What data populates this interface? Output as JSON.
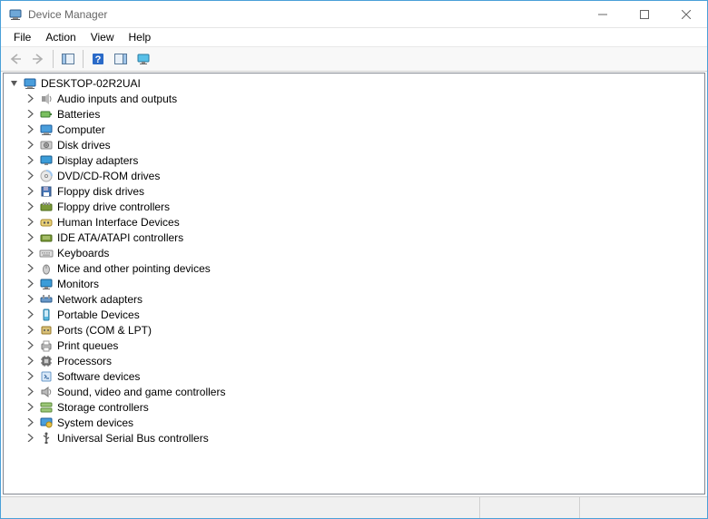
{
  "window": {
    "title": "Device Manager"
  },
  "menu": {
    "file": "File",
    "action": "Action",
    "view": "View",
    "help": "Help"
  },
  "toolbar": {
    "back": "back",
    "forward": "forward",
    "show_hide": "show-hide-console-tree",
    "help": "help",
    "action_pane": "show-hide-action-pane",
    "monitor": "monitor-action"
  },
  "tree": {
    "root": "DESKTOP-02R2UAI",
    "categories": [
      {
        "label": "Audio inputs and outputs",
        "icon": "speaker"
      },
      {
        "label": "Batteries",
        "icon": "battery"
      },
      {
        "label": "Computer",
        "icon": "computer"
      },
      {
        "label": "Disk drives",
        "icon": "disk"
      },
      {
        "label": "Display adapters",
        "icon": "display"
      },
      {
        "label": "DVD/CD-ROM drives",
        "icon": "dvd"
      },
      {
        "label": "Floppy disk drives",
        "icon": "floppy"
      },
      {
        "label": "Floppy drive controllers",
        "icon": "controller"
      },
      {
        "label": "Human Interface Devices",
        "icon": "hid"
      },
      {
        "label": "IDE ATA/ATAPI controllers",
        "icon": "ide"
      },
      {
        "label": "Keyboards",
        "icon": "keyboard"
      },
      {
        "label": "Mice and other pointing devices",
        "icon": "mouse"
      },
      {
        "label": "Monitors",
        "icon": "monitor"
      },
      {
        "label": "Network adapters",
        "icon": "network"
      },
      {
        "label": "Portable Devices",
        "icon": "portable"
      },
      {
        "label": "Ports (COM & LPT)",
        "icon": "port"
      },
      {
        "label": "Print queues",
        "icon": "printer"
      },
      {
        "label": "Processors",
        "icon": "cpu"
      },
      {
        "label": "Software devices",
        "icon": "software"
      },
      {
        "label": "Sound, video and game controllers",
        "icon": "sound"
      },
      {
        "label": "Storage controllers",
        "icon": "storage"
      },
      {
        "label": "System devices",
        "icon": "system"
      },
      {
        "label": "Universal Serial Bus controllers",
        "icon": "usb"
      }
    ]
  }
}
